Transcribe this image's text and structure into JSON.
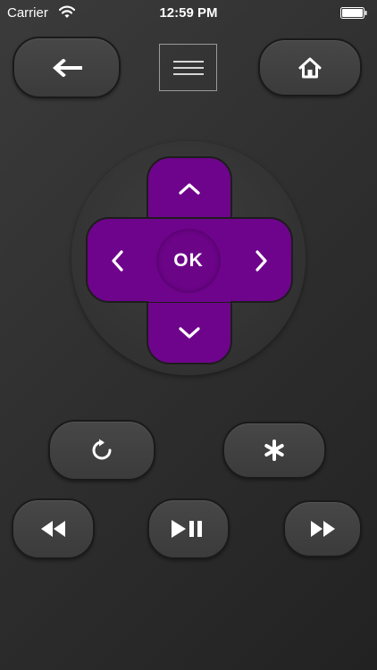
{
  "status_bar": {
    "carrier": "Carrier",
    "time": "12:59 PM",
    "wifi_icon": "wifi-icon",
    "battery_icon": "battery-icon"
  },
  "nav": {
    "back_icon": "back-arrow-icon",
    "menu_icon": "hamburger-menu-icon",
    "home_icon": "home-icon"
  },
  "dpad": {
    "ok_label": "OK",
    "up_icon": "chevron-up-icon",
    "down_icon": "chevron-down-icon",
    "left_icon": "chevron-left-icon",
    "right_icon": "chevron-right-icon"
  },
  "controls": {
    "replay_icon": "replay-icon",
    "options_icon": "asterisk-icon",
    "rewind_icon": "rewind-icon",
    "play_pause_icon": "play-pause-icon",
    "fast_forward_icon": "fast-forward-icon"
  },
  "colors": {
    "accent": "#6e048b",
    "background": "#2e2e2e",
    "button": "#424242",
    "icon": "#ffffff"
  }
}
